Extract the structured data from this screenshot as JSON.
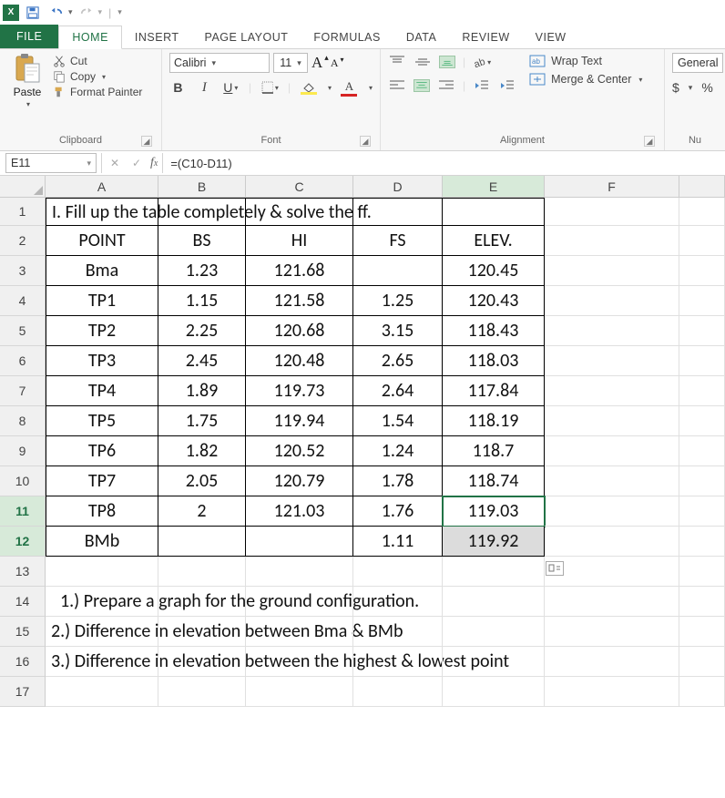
{
  "qat": {
    "save": "",
    "undo": "",
    "redo": ""
  },
  "tabs": {
    "file": "FILE",
    "home": "HOME",
    "insert": "INSERT",
    "pagelayout": "PAGE LAYOUT",
    "formulas": "FORMULAS",
    "data": "DATA",
    "review": "REVIEW",
    "view": "VIEW"
  },
  "ribbon": {
    "clipboard": {
      "paste": "Paste",
      "cut": "Cut",
      "copy": "Copy",
      "formatpainter": "Format Painter",
      "label": "Clipboard"
    },
    "font": {
      "name": "Calibri",
      "size": "11",
      "label": "Font",
      "A_big": "A",
      "A_small": "A",
      "bold": "B",
      "italic": "I",
      "underline": "U",
      "fontcolor": "A"
    },
    "alignment": {
      "wrap": "Wrap Text",
      "merge": "Merge & Center",
      "label": "Alignment"
    },
    "number": {
      "format": "General",
      "label": "Nu",
      "dollar": "$",
      "percent": "%"
    }
  },
  "namebox": "E11",
  "formula": "=(C10-D11)",
  "columns": {
    "A": "A",
    "B": "B",
    "C": "C",
    "D": "D",
    "E": "E",
    "F": "F"
  },
  "rows": {
    "r1": "1",
    "r2": "2",
    "r3": "3",
    "r4": "4",
    "r5": "5",
    "r6": "6",
    "r7": "7",
    "r8": "8",
    "r9": "9",
    "r10": "10",
    "r11": "11",
    "r12": "12",
    "r13": "13",
    "r14": "14",
    "r15": "15",
    "r16": "16",
    "r17": "17"
  },
  "sheet": {
    "title": "I. Fill up the table completely & solve the ff.",
    "headers": {
      "point": "POINT",
      "bs": "BS",
      "hi": "HI",
      "fs": "FS",
      "elev": "ELEV."
    },
    "data": [
      {
        "point": "Bma",
        "bs": "1.23",
        "hi": "121.68",
        "fs": "",
        "elev": "120.45"
      },
      {
        "point": "TP1",
        "bs": "1.15",
        "hi": "121.58",
        "fs": "1.25",
        "elev": "120.43"
      },
      {
        "point": "TP2",
        "bs": "2.25",
        "hi": "120.68",
        "fs": "3.15",
        "elev": "118.43"
      },
      {
        "point": "TP3",
        "bs": "2.45",
        "hi": "120.48",
        "fs": "2.65",
        "elev": "118.03"
      },
      {
        "point": "TP4",
        "bs": "1.89",
        "hi": "119.73",
        "fs": "2.64",
        "elev": "117.84"
      },
      {
        "point": "TP5",
        "bs": "1.75",
        "hi": "119.94",
        "fs": "1.54",
        "elev": "118.19"
      },
      {
        "point": "TP6",
        "bs": "1.82",
        "hi": "120.52",
        "fs": "1.24",
        "elev": "118.7"
      },
      {
        "point": "TP7",
        "bs": "2.05",
        "hi": "120.79",
        "fs": "1.78",
        "elev": "118.74"
      },
      {
        "point": "TP8",
        "bs": "2",
        "hi": "121.03",
        "fs": "1.76",
        "elev": "119.03"
      },
      {
        "point": "BMb",
        "bs": "",
        "hi": "",
        "fs": "1.11",
        "elev": "119.92"
      }
    ],
    "q1": "1.) Prepare a graph for the ground configuration.",
    "q2": "2.) Difference in elevation between Bma & BMb",
    "q3": "3.) Difference in elevation between the highest & lowest point"
  },
  "chart_data": {
    "type": "table",
    "title": "Differential Leveling Table",
    "columns": [
      "POINT",
      "BS",
      "HI",
      "FS",
      "ELEV."
    ],
    "rows": [
      [
        "Bma",
        1.23,
        121.68,
        null,
        120.45
      ],
      [
        "TP1",
        1.15,
        121.58,
        1.25,
        120.43
      ],
      [
        "TP2",
        2.25,
        120.68,
        3.15,
        118.43
      ],
      [
        "TP3",
        2.45,
        120.48,
        2.65,
        118.03
      ],
      [
        "TP4",
        1.89,
        119.73,
        2.64,
        117.84
      ],
      [
        "TP5",
        1.75,
        119.94,
        1.54,
        118.19
      ],
      [
        "TP6",
        1.82,
        120.52,
        1.24,
        118.7
      ],
      [
        "TP7",
        2.05,
        120.79,
        1.78,
        118.74
      ],
      [
        "TP8",
        2,
        121.03,
        1.76,
        119.03
      ],
      [
        "BMb",
        null,
        null,
        1.11,
        119.92
      ]
    ]
  }
}
